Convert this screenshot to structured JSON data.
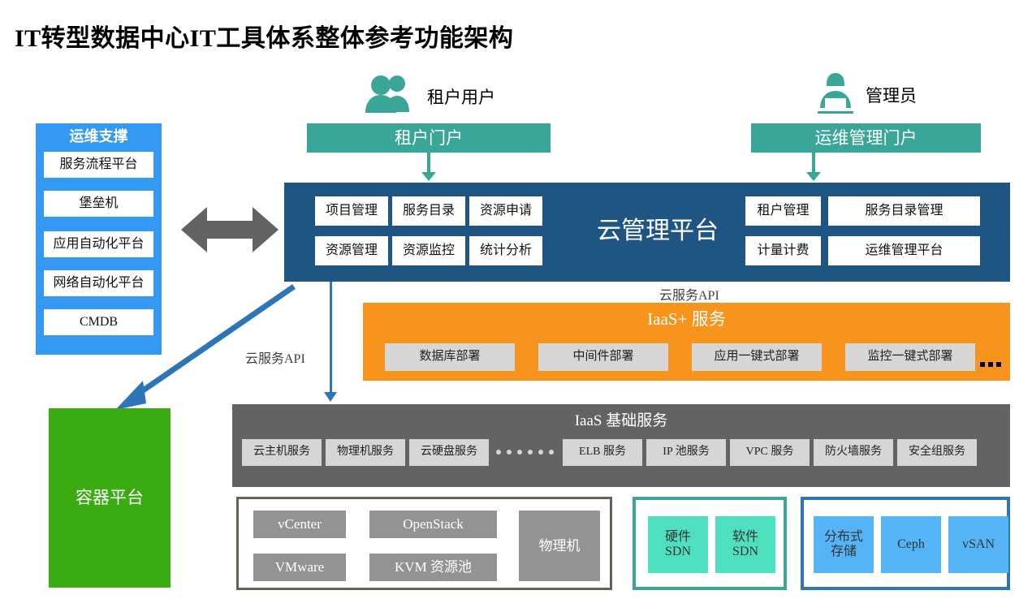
{
  "page": {
    "title": "IT转型数据中心IT工具体系整体参考功能架构"
  },
  "personas": [
    {
      "id": "tenant-user",
      "label": "租户用户",
      "icon": "two-users-icon"
    },
    {
      "id": "administrator",
      "label": "管理员",
      "icon": "admin-laptop-icon"
    }
  ],
  "portals": [
    {
      "id": "tenant-portal",
      "label": "租户门户"
    },
    {
      "id": "ops-portal",
      "label": "运维管理门户"
    }
  ],
  "ops_support": {
    "title": "运维支撑",
    "items": [
      "服务流程平台",
      "堡垒机",
      "应用自动化平台",
      "网络自动化平台",
      "CMDB"
    ]
  },
  "cloud_platform": {
    "title": "云管理平台",
    "left_cells": [
      "项目管理",
      "服务目录",
      "资源申请",
      "资源管理",
      "资源监控",
      "统计分析"
    ],
    "right_cells": [
      "租户管理",
      "服务目录管理",
      "计量计费",
      "运维管理平台"
    ]
  },
  "api_labels": {
    "top": "云服务API",
    "left": "云服务API"
  },
  "iaas_plus": {
    "title": "IaaS+ 服务",
    "items": [
      "数据库部署",
      "中间件部署",
      "应用一键式部署",
      "监控一键式部署"
    ],
    "ellipsis": "..."
  },
  "iaas_base": {
    "title": "IaaS 基础服务",
    "left_items": [
      "云主机服务",
      "物理机服务",
      "云硬盘服务"
    ],
    "separator": "······",
    "right_items": [
      "ELB 服务",
      "IP 池服务",
      "VPC 服务",
      "防火墙服务",
      "安全组服务"
    ]
  },
  "container_platform": {
    "label": "容器平台"
  },
  "compute_group": {
    "tiles": [
      "vCenter",
      "OpenStack",
      "VMware",
      "KVM 资源池"
    ],
    "bare_metal": "物理机"
  },
  "sdn_group": {
    "tiles": [
      "硬件\nSDN",
      "软件\nSDN"
    ]
  },
  "storage_group": {
    "tiles": [
      "分布式\n存储",
      "Ceph",
      "vSAN"
    ]
  },
  "colors": {
    "teal": "#3aa698",
    "blue_panel": "#3399f2",
    "dark_blue": "#1f5582",
    "orange": "#f7941d",
    "gray_band": "#636363",
    "green": "#3aab11",
    "arrow_gray": "#636363",
    "arrow_blue": "#2e75b6",
    "tile_gray": "#939393",
    "tile_teal": "#4fe0bf",
    "tile_blue": "#54b4f5"
  }
}
